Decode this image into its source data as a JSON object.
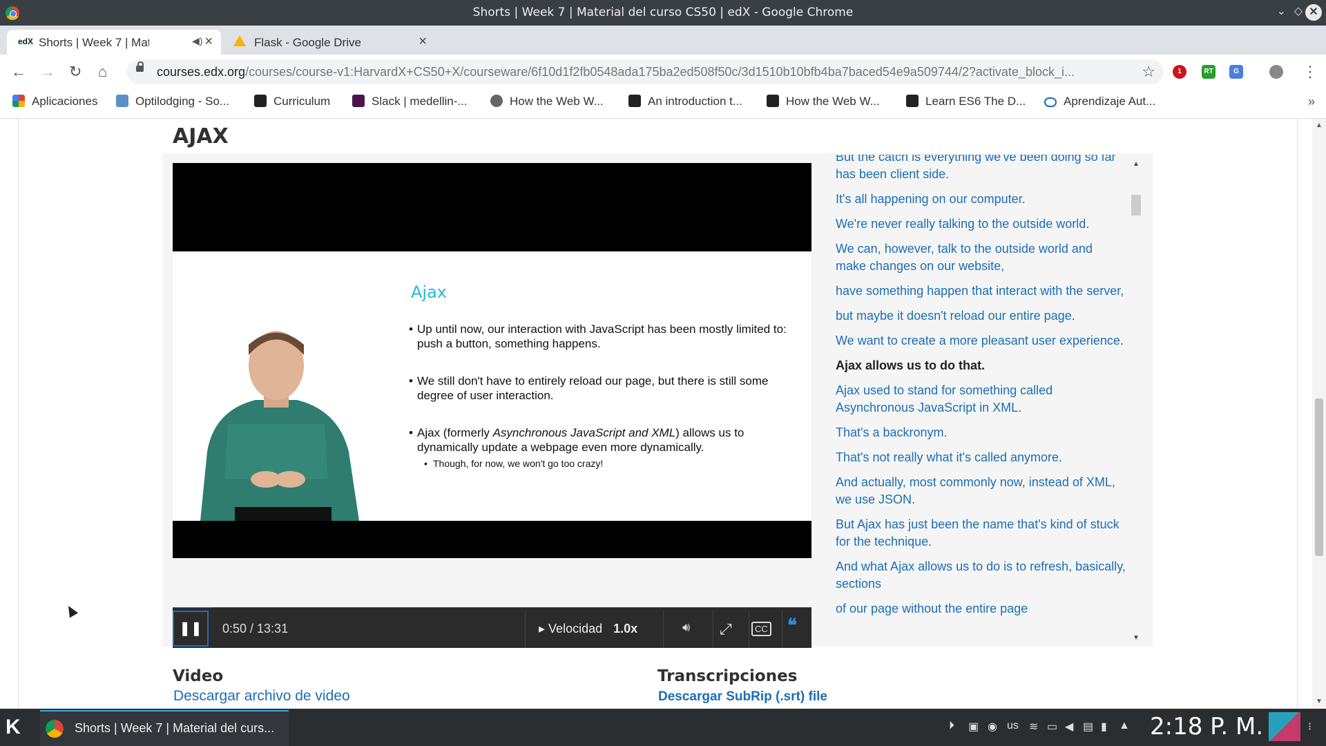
{
  "window": {
    "title": "Shorts | Week 7 | Material del curso CS50 | edX - Google Chrome"
  },
  "tabs": [
    {
      "favicon": "edX",
      "label": "Shorts | Week 7 | Materi",
      "audio_icon": "speaker-icon"
    },
    {
      "favicon": "google-drive-icon",
      "label": "Flask - Google Drive"
    }
  ],
  "address": {
    "host": "courses.edx.org",
    "path": "/courses/course-v1:HarvardX+CS50+X/courseware/6f10d1f2fb0548ada175ba2ed508f50c/3d1510b10bfb4ba7baced54e9a509744/2?activate_block_i..."
  },
  "extensions": [
    {
      "name": "ublock-icon",
      "badge": "1"
    },
    {
      "name": "rt-icon"
    },
    {
      "name": "translate-icon"
    },
    {
      "name": "profile-icon"
    }
  ],
  "bookmarks": [
    "Aplicaciones",
    "Optilodging - So...",
    "Curriculum",
    "Slack | medellin-...",
    "How the Web W...",
    "An introduction t...",
    "How the Web W...",
    "Learn ES6 The D...",
    "Aprendizaje Aut..."
  ],
  "unit": {
    "heading": "AJAX"
  },
  "slide": {
    "title": "Ajax",
    "bullet1": "Up until now, our interaction with JavaScript has been mostly limited to: push a button, something happens.",
    "bullet2": "We still don't have to entirely reload our page, but there is still some degree of user interaction.",
    "bullet3_pre": "Ajax (formerly ",
    "bullet3_em": "Asynchronous JavaScript and XML",
    "bullet3_post": ") allows us to dynamically update a webpage even more dynamically.",
    "sub1": "Though, for now, we won't go too crazy!"
  },
  "player": {
    "time": "0:50 / 13:31",
    "progress": 0.062,
    "speed_label": "Velocidad",
    "speed_value": "1.0x"
  },
  "transcript": [
    "But the catch is everything we've been doing so far has been client side.",
    "It's all happening on our computer.",
    "We're never really talking to the outside world.",
    "We can, however, talk to the outside world and make changes on our website,",
    "have something happen that interact with the server,",
    "but maybe it doesn't reload our entire page.",
    "We want to create a more pleasant user experience.",
    "Ajax allows us to do that.",
    "Ajax used to stand for something called Asynchronous JavaScript in XML.",
    "That's a backronym.",
    "That's not really what it's called anymore.",
    "And actually, most commonly now, instead of XML, we use JSON.",
    "But Ajax has just been the name that's kind of stuck for the technique.",
    "And what Ajax allows us to do is to refresh, basically, sections",
    "of our page without the entire page"
  ],
  "downloads": {
    "video_heading": "Video",
    "video_link": "Descargar archivo de video",
    "transcript_heading": "Transcripciones",
    "transcript_link": "Descargar SubRip (.srt) file"
  },
  "taskbar": {
    "task_label": "Shorts | Week 7 | Material del curs...",
    "keyboard": "us",
    "clock": "2:18 P. M."
  }
}
